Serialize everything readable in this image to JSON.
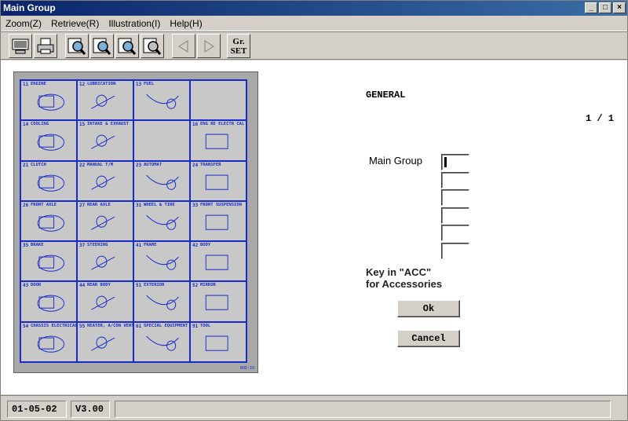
{
  "window": {
    "title": "Main Group"
  },
  "menu": [
    {
      "label": "Zoom(Z)"
    },
    {
      "label": "Retrieve(R)"
    },
    {
      "label": "Illustration(I)"
    },
    {
      "label": "Help(H)"
    }
  ],
  "toolbar": {
    "gr_line1": "Gr.",
    "gr_line2": "SET"
  },
  "board": {
    "code": "BOD:10",
    "cells": [
      {
        "num": "11",
        "name": "ENGINE"
      },
      {
        "num": "12",
        "name": "LUBRICATION"
      },
      {
        "num": "13",
        "name": "FUEL"
      },
      {
        "num": "",
        "name": ""
      },
      {
        "num": "14",
        "name": "COOLING"
      },
      {
        "num": "15",
        "name": "INTAKE & EXHAUST"
      },
      {
        "num": "",
        "name": ""
      },
      {
        "num": "16",
        "name": "ENG RE ELECTR CAL"
      },
      {
        "num": "21",
        "name": "CLUTCH"
      },
      {
        "num": "22",
        "name": "MANUAL T/M"
      },
      {
        "num": "23",
        "name": "AUTOMAT"
      },
      {
        "num": "24",
        "name": "TRANSFER"
      },
      {
        "num": "26",
        "name": "FRONT AXLE"
      },
      {
        "num": "27",
        "name": "REAR AXLE"
      },
      {
        "num": "31",
        "name": "WHEEL & TIRE"
      },
      {
        "num": "33",
        "name": "FRONT SUSPENSION"
      },
      {
        "num": "35",
        "name": "BRAKE"
      },
      {
        "num": "37",
        "name": "STEERING"
      },
      {
        "num": "41",
        "name": "FRAME"
      },
      {
        "num": "42",
        "name": "BODY"
      },
      {
        "num": "43",
        "name": "DOOR"
      },
      {
        "num": "44",
        "name": "REAR BODY"
      },
      {
        "num": "51",
        "name": "EXTERIOR"
      },
      {
        "num": "52",
        "name": "MIRROR"
      },
      {
        "num": "54",
        "name": "CHASSIS ELECTRICAL"
      },
      {
        "num": "55",
        "name": "HEATER, A/CON VENTILATION"
      },
      {
        "num": "61",
        "name": "SPECIAL EQUIPMENT"
      },
      {
        "num": "91",
        "name": "TOOL"
      }
    ]
  },
  "panel": {
    "general": "GENERAL",
    "page": "1 / 1",
    "main_group_label": "Main Group",
    "hint_line1": "Key in \"ACC\"",
    "hint_line2": "for Accessories",
    "ok_label": "Ok",
    "cancel_label": "Cancel"
  },
  "status": {
    "date": "01-05-02",
    "version": "V3.00"
  }
}
